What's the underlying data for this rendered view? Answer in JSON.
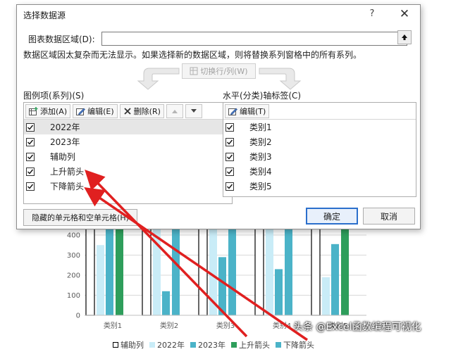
{
  "dialog": {
    "title": "选择数据源",
    "help": "?",
    "close": "✕",
    "range_label": "图表数据区域(D):",
    "range_value": "",
    "range_note": "数据区域因太复杂而无法显示。如果选择新的数据区域，则将替换系列窗格中的所有系列。",
    "switch_label": "切换行/列(W)",
    "legend_panel_label": "图例项(系列)(S)",
    "axis_panel_label": "水平(分类)轴标签(C)",
    "add_label": "添加(A)",
    "edit_label": "编辑(E)",
    "delete_label": "删除(R)",
    "axis_edit_label": "编辑(T)",
    "series": [
      {
        "label": "2022年",
        "checked": true,
        "selected": true
      },
      {
        "label": "2023年",
        "checked": true
      },
      {
        "label": "辅助列",
        "checked": true
      },
      {
        "label": "上升箭头",
        "checked": true
      },
      {
        "label": "下降箭头",
        "checked": true
      }
    ],
    "categories": [
      {
        "label": "类别1",
        "checked": true
      },
      {
        "label": "类别2",
        "checked": true
      },
      {
        "label": "类别3",
        "checked": true
      },
      {
        "label": "类别4",
        "checked": true
      },
      {
        "label": "类别5",
        "checked": true
      }
    ],
    "hidden_cells_label": "隐藏的单元格和空单元格(H)",
    "ok_label": "确定",
    "cancel_label": "取消"
  },
  "watermark": "头条 @Excel函数编程可视化",
  "colors": {
    "accent": "#2b6fcc",
    "arrow": "#e02020",
    "light_blue": "#c9ecf7",
    "teal": "#4bb3c8",
    "green": "#2e9e5b"
  },
  "chart_data": {
    "type": "bar",
    "categories": [
      "类别1",
      "类别2",
      "类别3",
      "类别4",
      "类别5"
    ],
    "yticks": [
      0,
      100,
      200,
      300,
      400
    ],
    "ylim": [
      0,
      450
    ],
    "series": [
      {
        "name": "辅助列",
        "values": [
          450,
          450,
          450,
          450,
          450
        ],
        "color": "#ffffff",
        "stroke": "#000000"
      },
      {
        "name": "2022年",
        "values": [
          350,
          450,
          450,
          450,
          190
        ],
        "color": "#c9ecf7"
      },
      {
        "name": "2023年",
        "values": [
          450,
          120,
          290,
          230,
          355
        ],
        "color": "#4bb3c8"
      },
      {
        "name": "上升箭头",
        "values": [
          450,
          0,
          0,
          0,
          450
        ],
        "color": "#2e9e5b"
      },
      {
        "name": "下降箭头",
        "values": [
          0,
          450,
          450,
          450,
          0
        ],
        "color": "#4bb3c8"
      }
    ],
    "legend_position": "bottom"
  }
}
